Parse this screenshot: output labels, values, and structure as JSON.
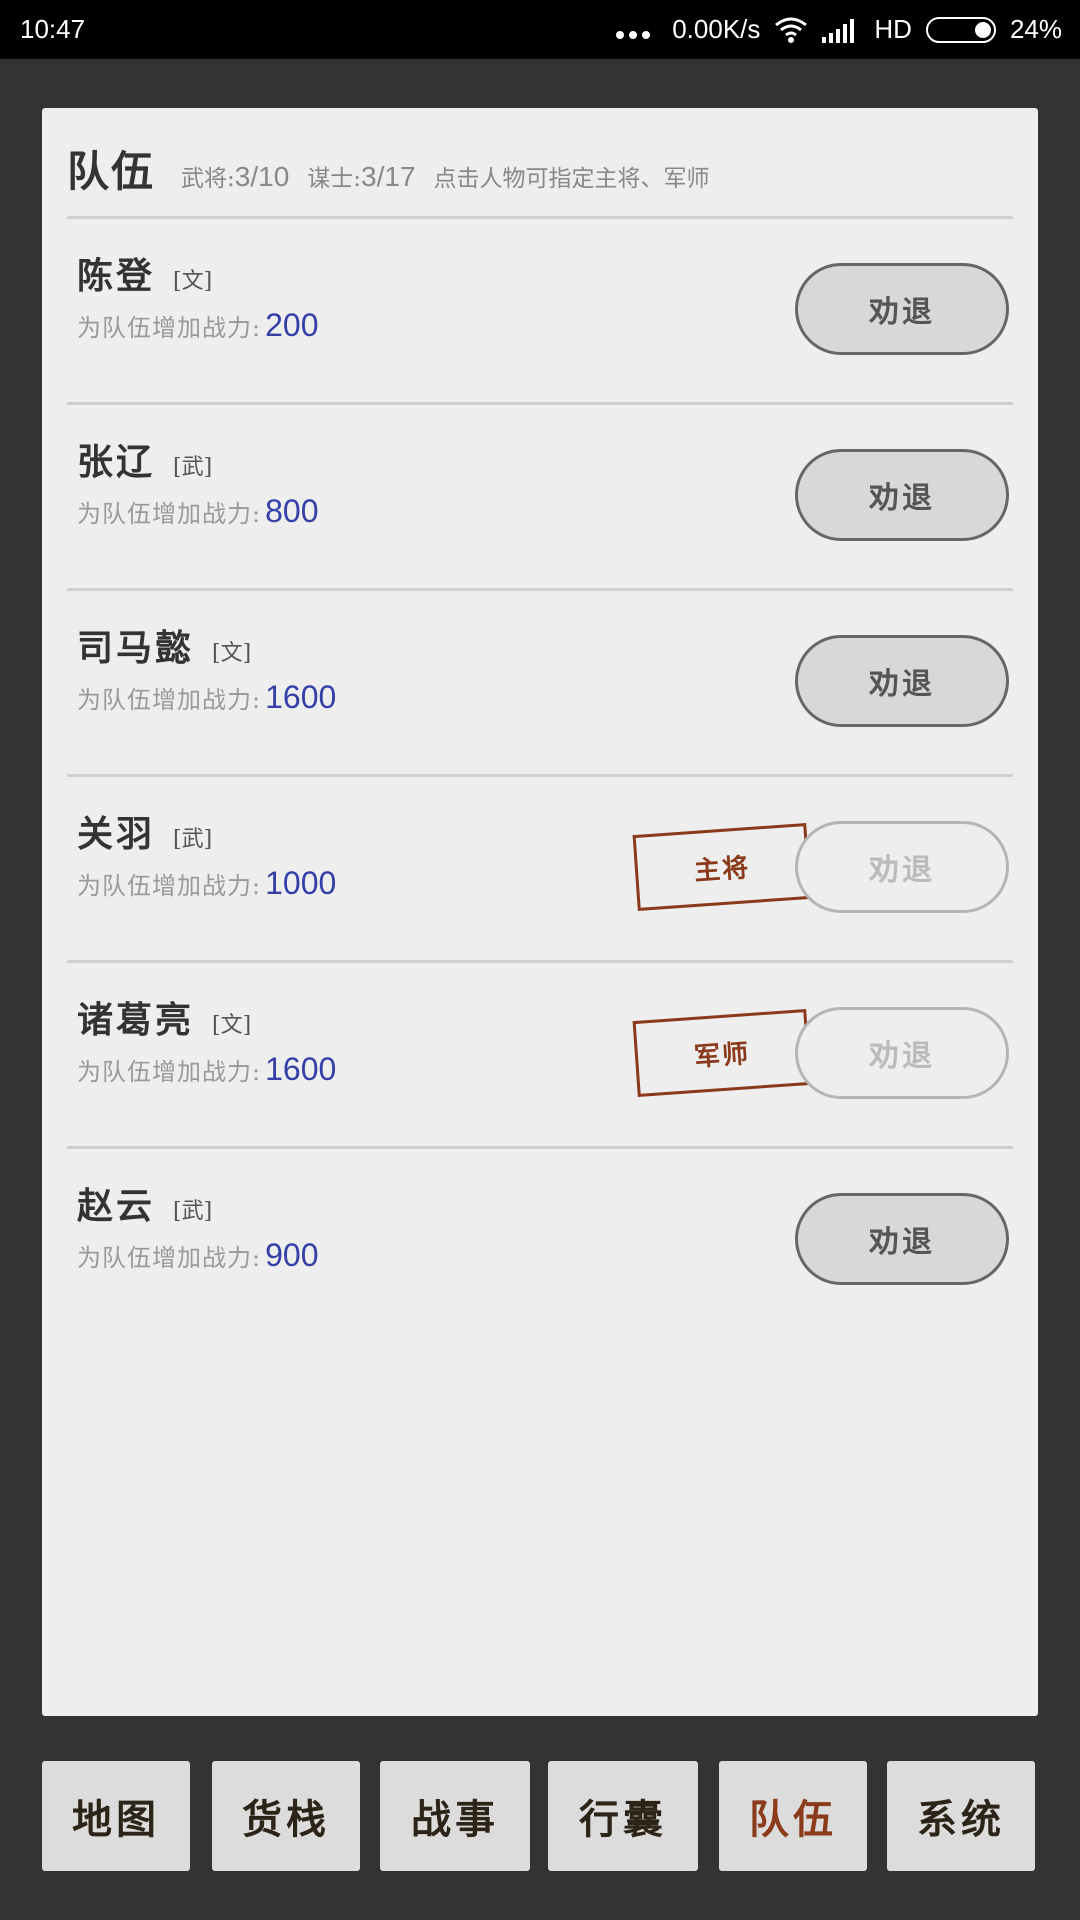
{
  "status_bar": {
    "time": "10:47",
    "net_speed": "0.00K/s",
    "network": "HD",
    "battery": "24%",
    "icons": [
      "dots-icon",
      "wifi-icon",
      "signal-icon",
      "battery-icon"
    ]
  },
  "panel": {
    "title": "队伍",
    "general_label": "武将:",
    "general_count": "3/10",
    "advisor_label": "谋士:",
    "advisor_count": "3/17",
    "hint": "点击人物可指定主将、军师"
  },
  "members": [
    {
      "name": "陈登",
      "type": "[文]",
      "power_label": "为队伍增加战力:",
      "power": "200",
      "action": "劝退",
      "stamp": "",
      "action_enabled": true
    },
    {
      "name": "张辽",
      "type": "[武]",
      "power_label": "为队伍增加战力:",
      "power": "800",
      "action": "劝退",
      "stamp": "",
      "action_enabled": true
    },
    {
      "name": "司马懿",
      "type": "[文]",
      "power_label": "为队伍增加战力:",
      "power": "1600",
      "action": "劝退",
      "stamp": "",
      "action_enabled": true
    },
    {
      "name": "关羽",
      "type": "[武]",
      "power_label": "为队伍增加战力:",
      "power": "1000",
      "action": "劝退",
      "stamp": "主将",
      "action_enabled": false
    },
    {
      "name": "诸葛亮",
      "type": "[文]",
      "power_label": "为队伍增加战力:",
      "power": "1600",
      "action": "劝退",
      "stamp": "军师",
      "action_enabled": false
    },
    {
      "name": "赵云",
      "type": "[武]",
      "power_label": "为队伍增加战力:",
      "power": "900",
      "action": "劝退",
      "stamp": "",
      "action_enabled": true
    }
  ],
  "tabs": [
    {
      "label": "地图",
      "active": false
    },
    {
      "label": "货栈",
      "active": false
    },
    {
      "label": "战事",
      "active": false
    },
    {
      "label": "行囊",
      "active": false
    },
    {
      "label": "队伍",
      "active": true
    },
    {
      "label": "系统",
      "active": false
    }
  ],
  "colors": {
    "background": "#333333",
    "panel": "#eeeeee",
    "power_value": "#3440a8",
    "stamp": "#8a3a1a",
    "active_tab": "#8b3a1a"
  }
}
